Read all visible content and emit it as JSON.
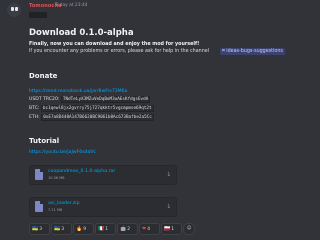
{
  "message": {
    "author": "Tomonocha",
    "timestamp": "Today at 23:44",
    "title": "Download 0.1.0-alpha",
    "intro_bold": "Finally, now you can download and enjoy the mod for yourself!",
    "intro_help": "If you encounter any problems or errors, please ask for help in the channel",
    "help_channel": "ideas-bugs-suggestions",
    "donate_heading": "Donate",
    "donate_link": "https://send.monobank.ua/jar/8wFrs73M6a",
    "crypto": [
      {
        "label": "USDT TRC20:",
        "address": "TNdTeLyX3MZuVeDqBoM3oAEsKfdgsEvdA"
      },
      {
        "label": "BTC:",
        "address": "bc1qewl8jx2gvrry75j727qkktr5vgcmpmse69qt2t"
      },
      {
        "label": "ETH:",
        "address": "0xE7a8D448A147B6620BC9061b8Ac673Bafbe2a5Cc"
      }
    ],
    "tutorial_heading": "Tutorial",
    "tutorial_link": "https://youtu.be/jaJwF6sdaVc",
    "files": [
      {
        "name": "coopandreas_0.1.0-alpha.rar",
        "size": "10.06 MB"
      },
      {
        "name": "asi_loader.zip",
        "size": "7.11 MB"
      }
    ],
    "reactions": [
      {
        "emoji": "🇺🇦",
        "count": "3"
      },
      {
        "emoji": "🇺🇦",
        "count": "3"
      },
      {
        "emoji": "🔥",
        "count": "9"
      },
      {
        "emoji": "🇮🇹",
        "count": "1"
      },
      {
        "emoji": "🤖",
        "count": "2"
      },
      {
        "emoji": "❤",
        "count": "4"
      },
      {
        "emoji": "🇵🇱",
        "count": "1"
      }
    ],
    "add_reaction_icon": "☺"
  }
}
